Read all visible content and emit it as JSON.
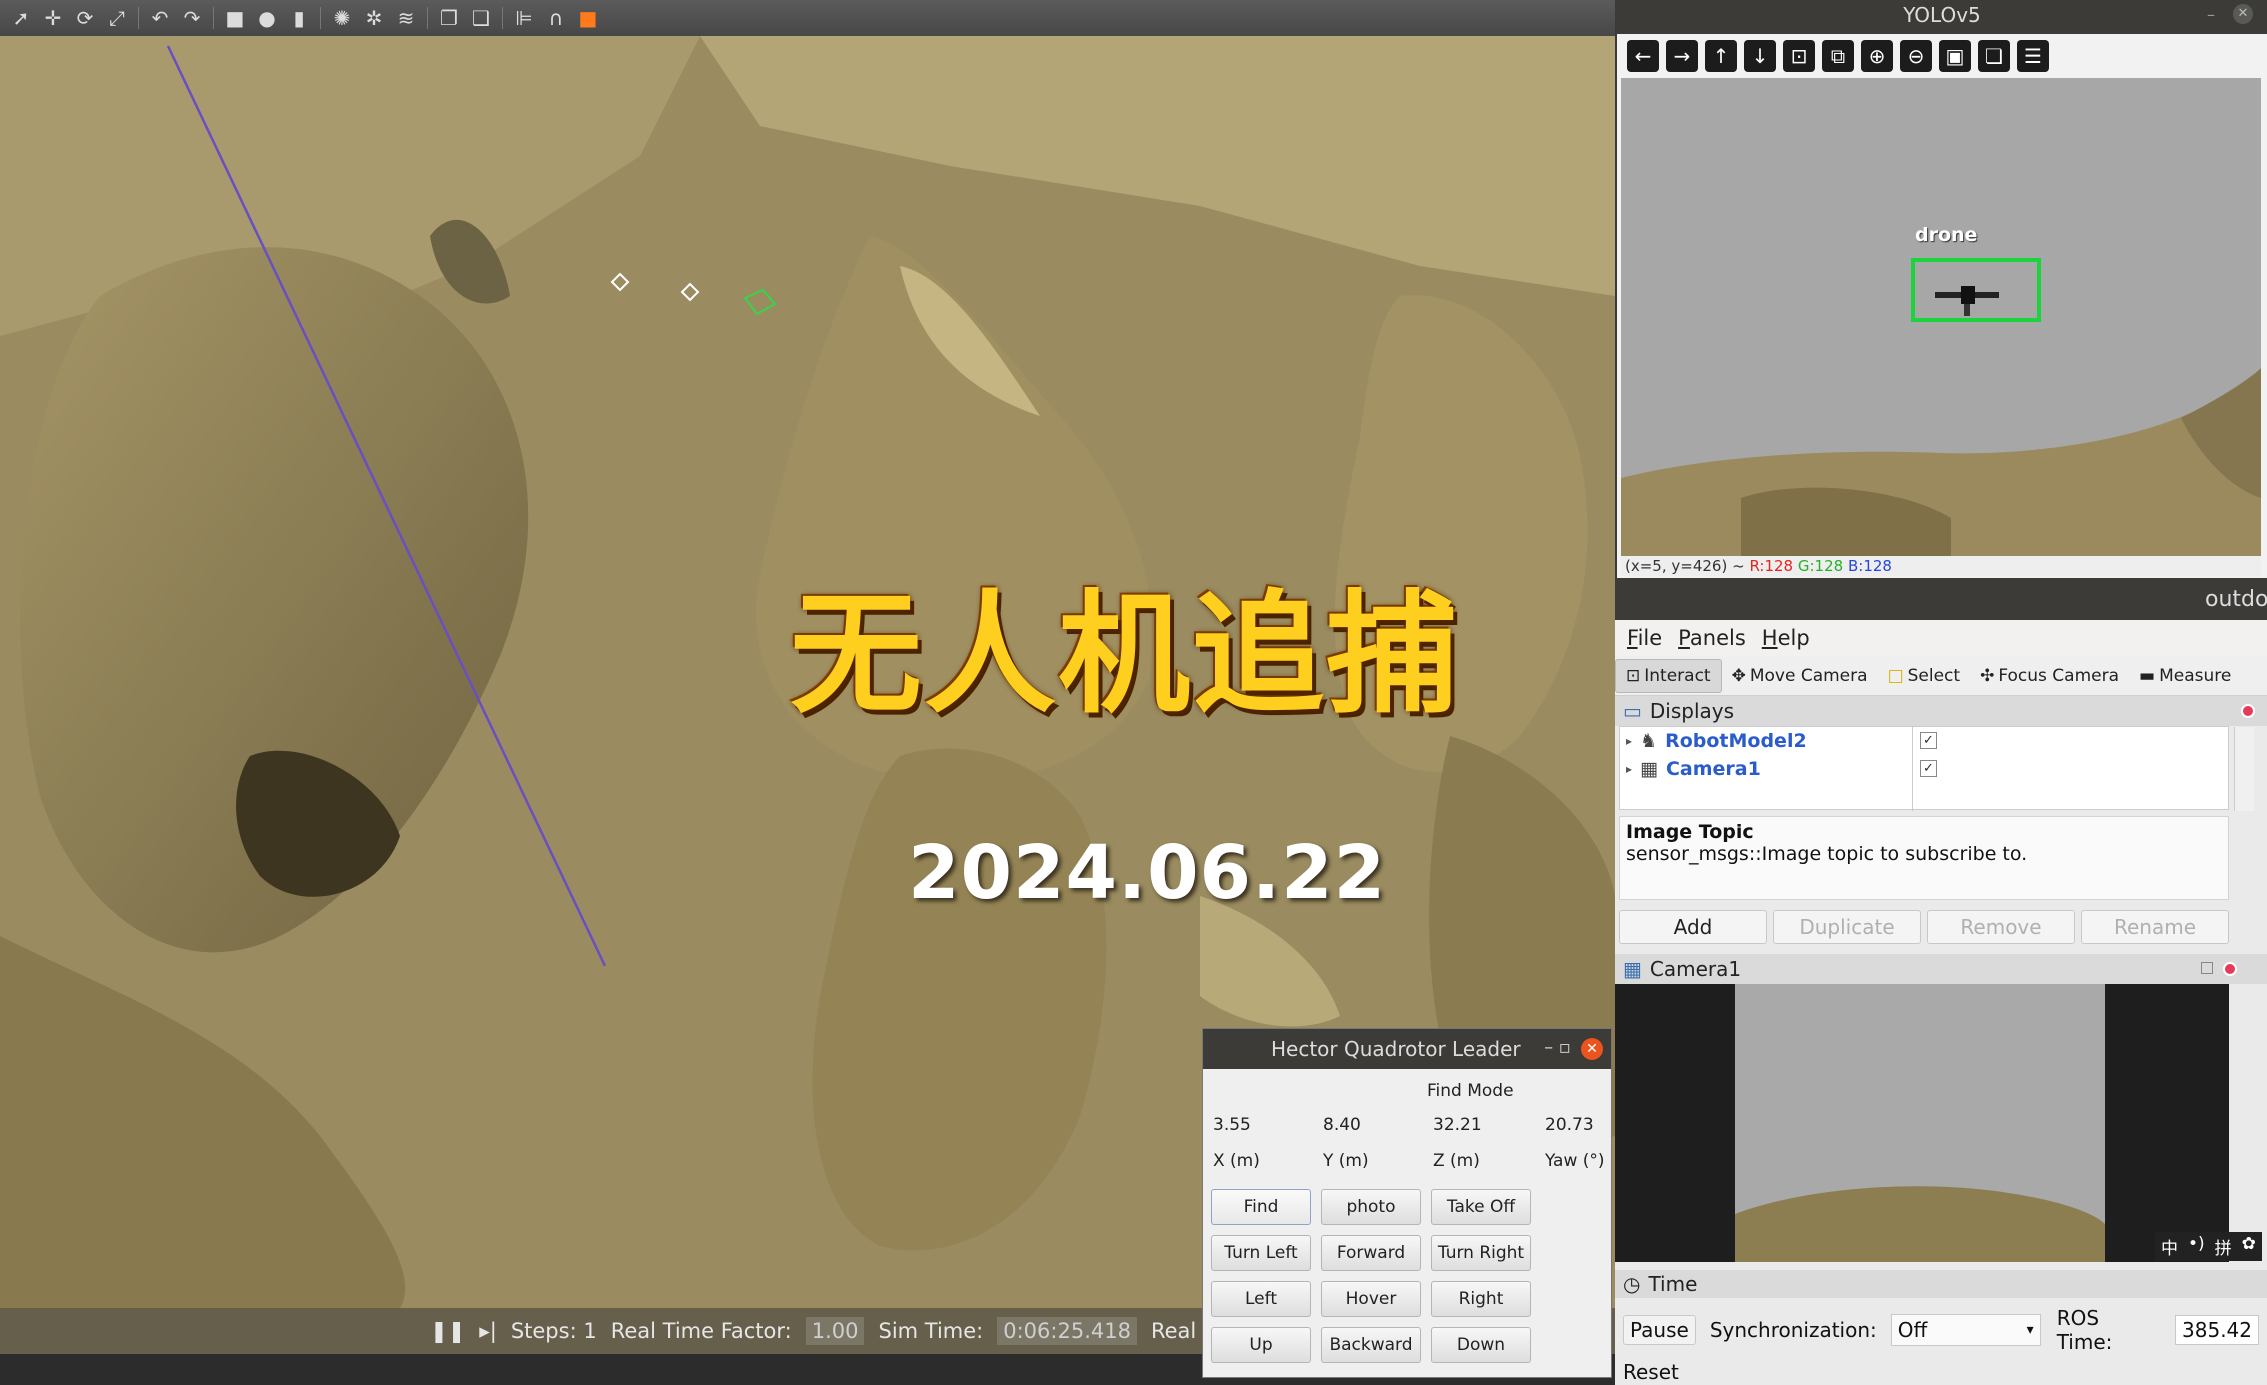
{
  "overlay": {
    "title": "无人机追捕",
    "date": "2024.06.22"
  },
  "gazebo": {
    "status": {
      "steps_label": "Steps: 1",
      "rtf_label": "Real Time Factor:",
      "rtf_value": "1.00",
      "sim_time_label": "Sim Time:",
      "sim_time_value": "0:06:25.418",
      "real_time_label": "Real Time:"
    }
  },
  "hector": {
    "title": "Hector Quadrotor Leader",
    "mode": "Find Mode",
    "values": [
      "3.55",
      "8.40",
      "32.21",
      "20.73"
    ],
    "labels": [
      "X (m)",
      "Y (m)",
      "Z (m)",
      "Yaw (°)"
    ],
    "buttons": [
      "Find",
      "photo",
      "Take Off",
      "Turn Left",
      "Forward",
      "Turn Right",
      "Left",
      "Hover",
      "Right",
      "Up",
      "Backward",
      "Down"
    ]
  },
  "yolo": {
    "title": "YOLOv5",
    "detection_label": "drone",
    "status_prefix": "(x=5, y=426) ~",
    "r": "R:128",
    "g": "G:128",
    "b": "B:128",
    "colors": {
      "box": "#1bd33c"
    }
  },
  "rviz": {
    "title": "outdoor",
    "menu": [
      "File",
      "Panels",
      "Help"
    ],
    "tools": [
      "Interact",
      "Move Camera",
      "Select",
      "Focus Camera",
      "Measure"
    ],
    "displays_title": "Displays",
    "displays": [
      "RobotModel2",
      "Camera1"
    ],
    "help_title": "Image Topic",
    "help_text": "sensor_msgs::Image topic to subscribe to.",
    "buttons": [
      "Add",
      "Duplicate",
      "Remove",
      "Rename"
    ],
    "camera_title": "Camera1",
    "time_title": "Time",
    "pause_label": "Pause",
    "sync_label": "Synchronization:",
    "sync_value": "Off",
    "ros_time_label": "ROS Time:",
    "ros_time_value": "385.42",
    "reset_label": "Reset",
    "ime": [
      "中",
      "•)",
      "拼",
      "✿"
    ]
  }
}
